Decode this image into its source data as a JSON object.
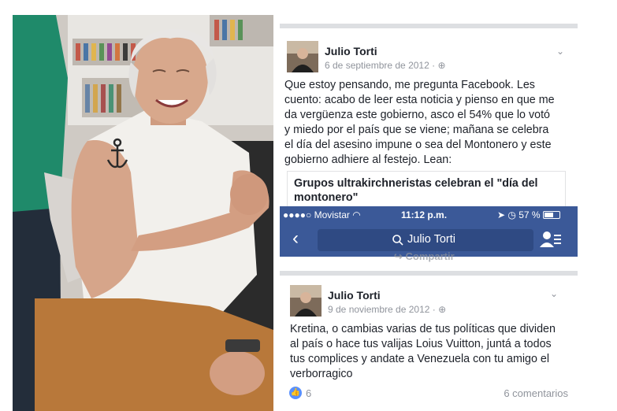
{
  "status_bar": {
    "carrier": "●●●●○ Movistar",
    "time": "11:12 p.m.",
    "battery": "57 %"
  },
  "nav": {
    "back_icon": "chevron-left-icon",
    "search_text": "Julio Torti",
    "search_icon": "search-icon",
    "friends_icon": "friends-icon"
  },
  "post1": {
    "author": "Julio Torti",
    "date": "6 de septiembre de 2012 · ",
    "lines": [
      "Que estoy pensando, me pregunta Facebook. Les",
      "cuento: acabo de leer esta noticia y pienso en que me",
      "da vergüenza este gobierno, asco el 54% que lo votó",
      "y miedo por el país que se viene; mañana se celebra",
      "el día del asesino impune o sea del Montonero y este",
      "gobierno adhiere al festejo. Lean:"
    ],
    "link_title_lines": [
      "Grupos ultrakirchneristas celebran el \"día del",
      "montonero\""
    ],
    "share_label": "Compartir"
  },
  "post2": {
    "author": "Julio Torti",
    "date": "9 de noviembre de 2012 · ",
    "lines": [
      "Kretina, o cambias varias de tus políticas que dividen",
      "al país o hace tus valijas Loius Vuitton, juntá a todos",
      "tus complices y andate a Venezuela con tu amigo el",
      "verborragico"
    ],
    "likes": "6",
    "comments": "6 comentarios"
  },
  "colors": {
    "facebook_blue": "#3b5998",
    "like_blue": "#5890ff",
    "meta_gray": "#90949c"
  }
}
